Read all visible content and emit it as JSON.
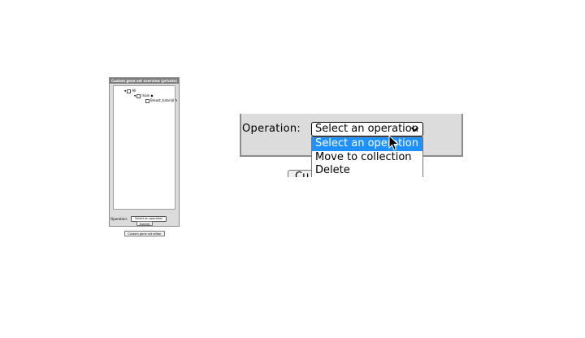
{
  "thumbnail": {
    "panel_title": "Custom gene set overview (private)",
    "tree": [
      {
        "label": "All",
        "expanded": true
      },
      {
        "label": "main",
        "expanded": true,
        "badge": "◆"
      },
      {
        "label": "Breast_tutorial",
        "expanded": false,
        "badge": "✎"
      }
    ],
    "operation_label": "Operation:",
    "operation_select_value": "Select an operation",
    "submit_label": "Submit",
    "custom_editor_button_label": "Custom gene set editor"
  },
  "zoom": {
    "operation_label": "Operation:",
    "select_value": "Select an operation",
    "options": [
      "Select an operation",
      "Move to collection",
      "Delete"
    ],
    "selected_index": 0,
    "submit_peek_label": "Cu"
  },
  "icons": {
    "expand": "triangle-down-icon",
    "cursor": "mouse-pointer-icon",
    "dropdown": "chevron-down-icon"
  },
  "colors": {
    "highlight": "#1e90ff",
    "panel_bg": "#dcdcdc",
    "panel_header": "#7d7d7d"
  }
}
